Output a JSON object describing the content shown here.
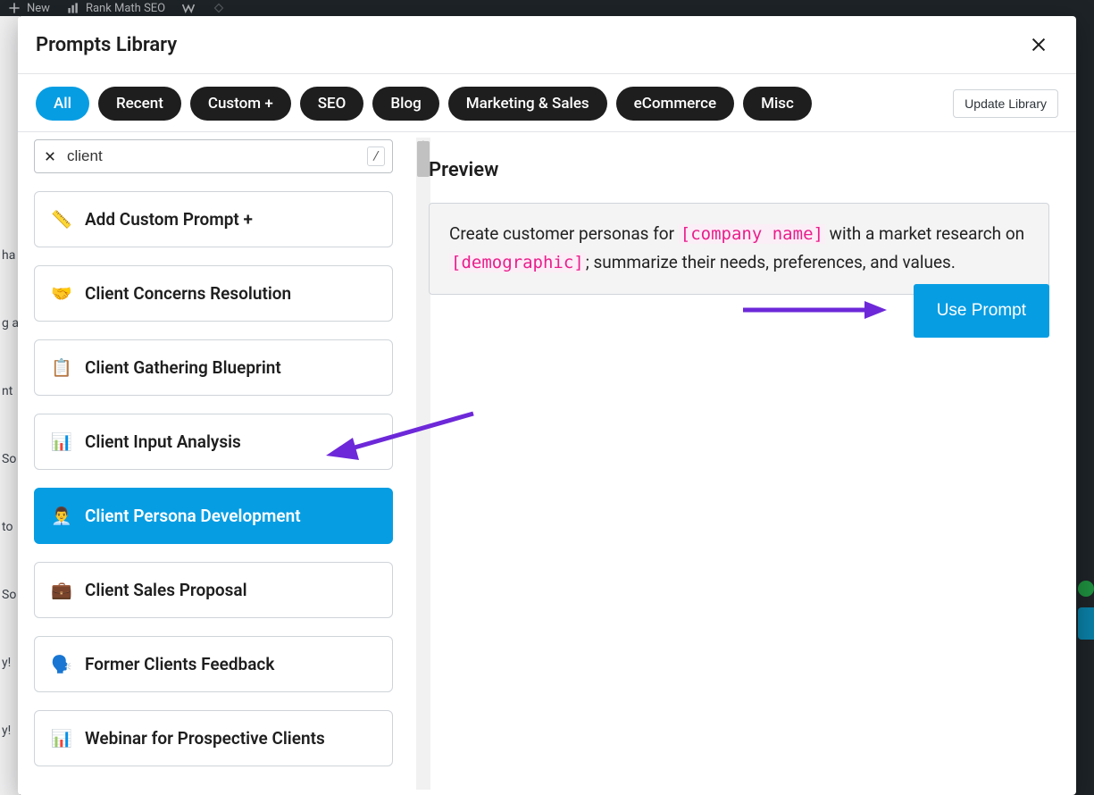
{
  "adminbar": {
    "new": "New",
    "rankmath": "Rank Math SEO"
  },
  "modal": {
    "title": "Prompts Library",
    "tabs": [
      "All",
      "Recent",
      "Custom +",
      "SEO",
      "Blog",
      "Marketing & Sales",
      "eCommerce",
      "Misc"
    ],
    "active_tab_index": 0,
    "update_button": "Update Library",
    "search": {
      "value": "client",
      "kbd": "/"
    },
    "prompts": [
      {
        "emoji": "📏",
        "label": "Add Custom Prompt +"
      },
      {
        "emoji": "🤝",
        "label": "Client Concerns Resolution"
      },
      {
        "emoji": "📋",
        "label": "Client Gathering Blueprint"
      },
      {
        "emoji": "📊",
        "label": "Client Input Analysis"
      },
      {
        "emoji": "👨‍💼",
        "label": "Client Persona Development"
      },
      {
        "emoji": "💼",
        "label": "Client Sales Proposal"
      },
      {
        "emoji": "🗣️",
        "label": "Former Clients Feedback"
      },
      {
        "emoji": "📊",
        "label": "Webinar for Prospective Clients"
      }
    ],
    "selected_prompt_index": 4,
    "preview": {
      "heading": "Preview",
      "text_pre": "Create customer personas for ",
      "var1": "[company name]",
      "text_mid": " with a market research on ",
      "var2": "[demographic]",
      "text_post": "; summarize their needs, preferences, and values."
    },
    "use_button": "Use Prompt"
  },
  "bg": {
    "rows": [
      "ha",
      "g a",
      "nt",
      "So",
      "to",
      "So",
      "y!",
      "y!"
    ]
  }
}
